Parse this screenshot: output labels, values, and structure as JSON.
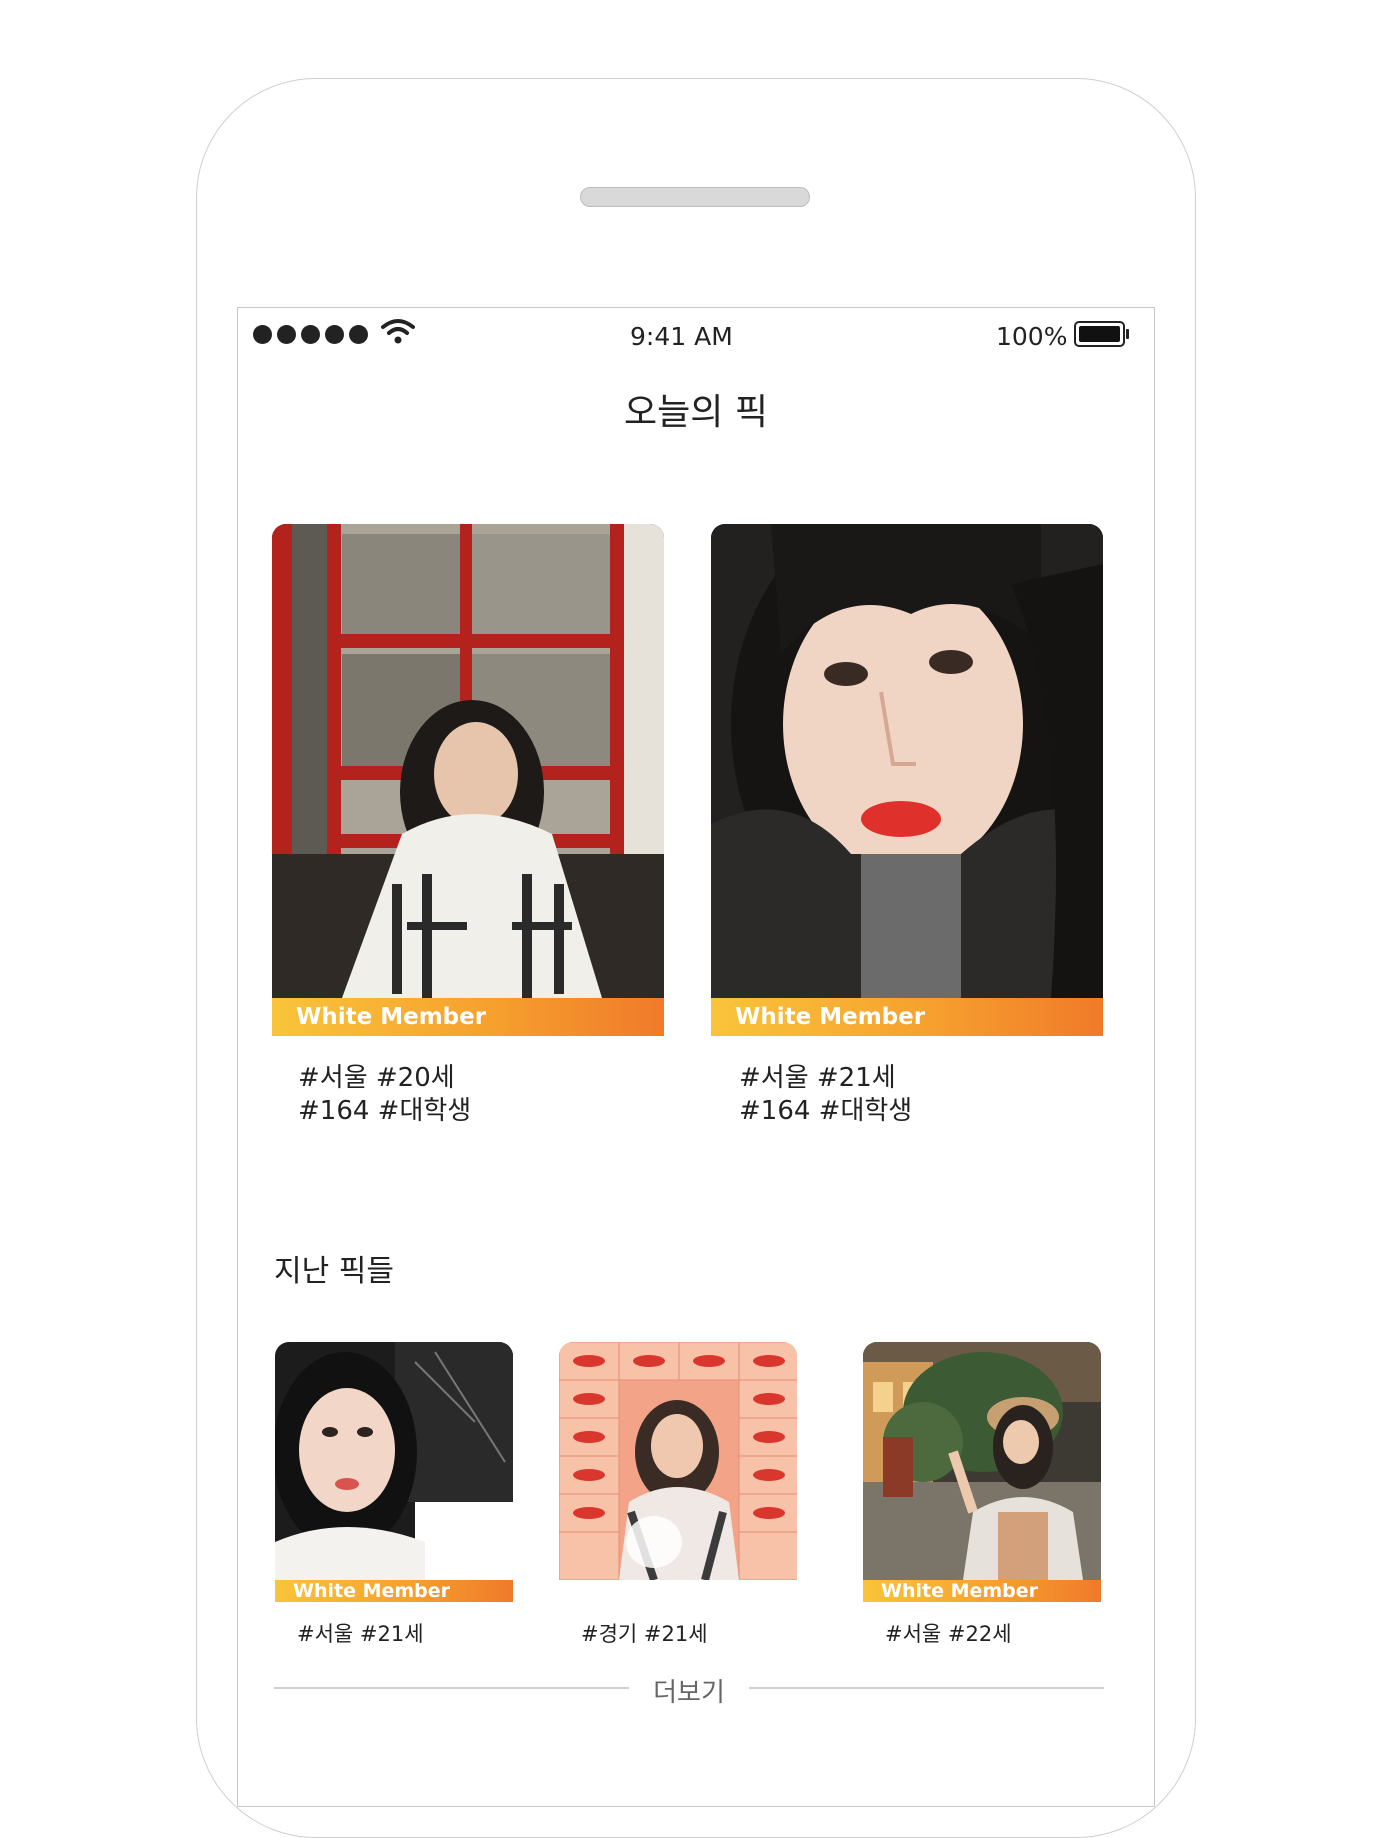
{
  "status_bar": {
    "time": "9:41 AM",
    "battery": "100%"
  },
  "screen": {
    "title": "오늘의 픽"
  },
  "today_picks": [
    {
      "badge": "White Member",
      "tags_line1": "#서울 #20세",
      "tags_line2": "#164 #대학생"
    },
    {
      "badge": "White Member",
      "tags_line1": "#서울 #21세",
      "tags_line2": "#164 #대학생"
    }
  ],
  "past_section": {
    "title": "지난 픽들"
  },
  "past_picks": [
    {
      "badge": "White Member",
      "tags": "#서울 #21세"
    },
    {
      "badge": "",
      "tags": "#경기 #21세"
    },
    {
      "badge": "White Member",
      "tags": "#서울 #22세"
    }
  ],
  "more_button": {
    "label": "더보기"
  },
  "colors": {
    "badge_start": "#f9c43a",
    "badge_end": "#f07a2a"
  }
}
